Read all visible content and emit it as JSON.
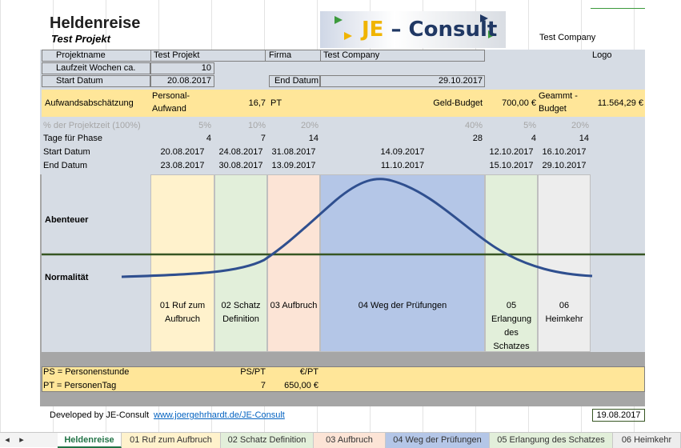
{
  "header": {
    "title": "Heldenreise",
    "subtitle": "Test Projekt",
    "company_top": "Test Company"
  },
  "logo": {
    "prefix": "JE",
    "suffix": " – Consult",
    "label": "Logo"
  },
  "info": {
    "projektname_label": "Projektname",
    "projektname": "Test Projekt",
    "firma_label": "Firma",
    "firma": "Test Company",
    "laufzeit_label": "Laufzeit Wochen ca.",
    "laufzeit": "10",
    "start_label": "Start Datum",
    "start": "20.08.2017",
    "end_label": "End Datum",
    "end": "29.10.2017"
  },
  "aufwand": {
    "label": "Aufwandsabschätzung",
    "personal_label": "Personal-Aufwand",
    "personal_value": "16,7",
    "pt": "PT",
    "budget_label": "Geld-Budget",
    "budget_value": "700,00 €",
    "gesamt_label": "Geammt - Budget",
    "gesamt_value": "11.564,29 €"
  },
  "table": {
    "row_labels": [
      "% der Projektzeit (100%)",
      "Tage für Phase",
      "Start Datum",
      "End Datum"
    ],
    "percent": [
      "5%",
      "10%",
      "20%",
      "40%",
      "5%",
      "20%"
    ],
    "days": [
      "4",
      "7",
      "14",
      "28",
      "4",
      "14"
    ],
    "start": [
      "20.08.2017",
      "24.08.2017",
      "31.08.2017",
      "14.09.2017",
      "12.10.2017",
      "16.10.2017"
    ],
    "end": [
      "23.08.2017",
      "30.08.2017",
      "13.09.2017",
      "11.10.2017",
      "15.10.2017",
      "29.10.2017"
    ]
  },
  "diagram": {
    "abenteuer": "Abenteuer",
    "normalitaet": "Normalität"
  },
  "phases": [
    "01 Ruf zum Aufbruch",
    "02 Schatz Definition",
    "03 Aufbruch",
    "04 Weg der Prüfungen",
    "05 Erlangung des Schatzes",
    "06 Heimkehr"
  ],
  "legend": {
    "ps": "PS = Personenstunde",
    "pt": "PT = PersonenTag",
    "ps_pt": "PS/PT",
    "eur_pt": "€/PT",
    "ps_pt_value": "7",
    "eur_pt_value": "650,00 €"
  },
  "footer": {
    "developed": "Developed by JE-Consult",
    "link": "www.joergehrhardt.de/JE-Consult",
    "date": "19.08.2017"
  },
  "tabs": [
    "Heldenreise",
    "01 Ruf zum Aufbruch",
    "02 Schatz Definition",
    "03 Aufbruch",
    "04 Weg der Prüfungen",
    "05 Erlangung des Schatzes",
    "06 Heimkehr"
  ],
  "colors": {
    "phase1": "#fff2cc",
    "phase2": "#e2efda",
    "phase3": "#fce4d6",
    "phase4": "#b4c6e7",
    "phase5": "#e2efda",
    "phase6": "#ededed",
    "curve": "#2f4f8f",
    "baseline": "#375623"
  }
}
